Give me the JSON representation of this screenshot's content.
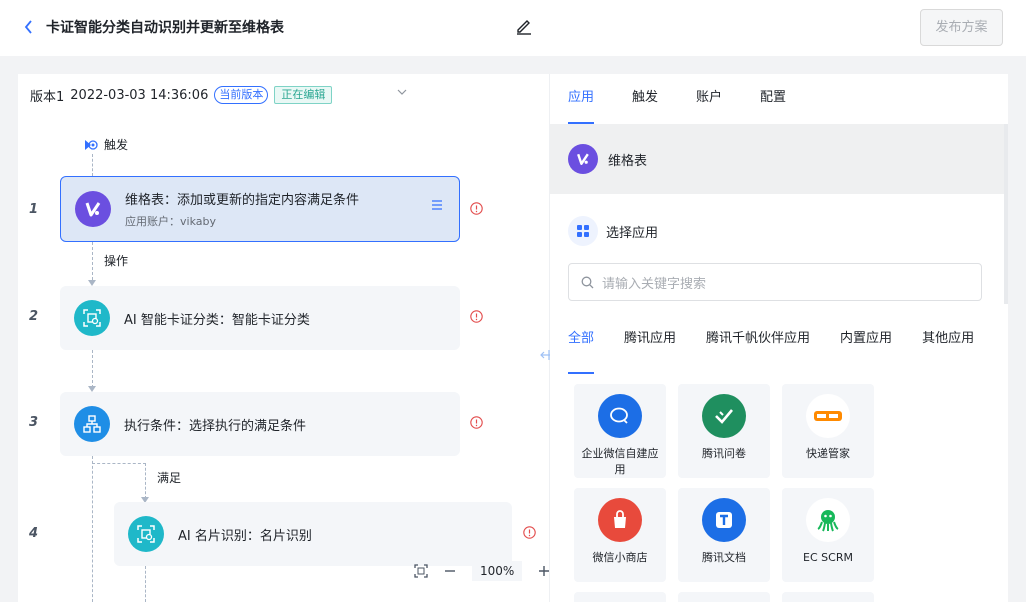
{
  "header": {
    "back_icon": "chevron-left-icon",
    "title": "卡证智能分类自动识别并更新至维格表",
    "edit_icon": "pencil-icon",
    "publish_label": "发布方案"
  },
  "version_bar": {
    "version": "版本1",
    "datetime": "2022-03-03 14:36:06",
    "current_badge": "当前版本",
    "editing_badge": "正在编辑"
  },
  "flow": {
    "trigger_label": "触发",
    "edge_operate": "操作",
    "edge_satisfy": "满足",
    "steps": [
      {
        "num": "1",
        "title": "维格表：添加或更新的指定内容满足条件",
        "subtitle": "应用账户：vikaby"
      },
      {
        "num": "2",
        "title": "AI 智能卡证分类：智能卡证分类"
      },
      {
        "num": "3",
        "title": "执行条件：选择执行的满足条件"
      },
      {
        "num": "4",
        "title": "AI 名片识别：名片识别"
      }
    ]
  },
  "zoom": {
    "level": "100%"
  },
  "panel": {
    "tabs": [
      "应用",
      "触发",
      "账户",
      "配置"
    ],
    "selected_app": "维格表",
    "choose_app_label": "选择应用",
    "search_placeholder": "请输入关键字搜索",
    "categories": [
      "全部",
      "腾讯应用",
      "腾讯千帆伙伴应用",
      "内置应用",
      "其他应用"
    ],
    "apps": [
      {
        "label": "企业微信自建应用",
        "icon_color": "#1c6ee6",
        "icon_name": "wecom-icon"
      },
      {
        "label": "腾讯问卷",
        "icon_color": "#1f8f5f",
        "icon_name": "survey-icon"
      },
      {
        "label": "快递管家",
        "icon_color": "#ffffff",
        "icon_name": "express-icon"
      },
      {
        "label": "微信小商店",
        "icon_color": "#e84a3c",
        "icon_name": "shop-icon"
      },
      {
        "label": "腾讯文档",
        "icon_color": "#1c6ee6",
        "icon_name": "docs-icon"
      },
      {
        "label": "EC SCRM",
        "icon_color": "#ffffff",
        "icon_name": "octopus-icon"
      }
    ]
  },
  "colors": {
    "accent": "#3370ff",
    "vika_purple": "#6b4fe0",
    "ai_teal": "#1fb8c9",
    "error_red": "#e34d4d"
  }
}
